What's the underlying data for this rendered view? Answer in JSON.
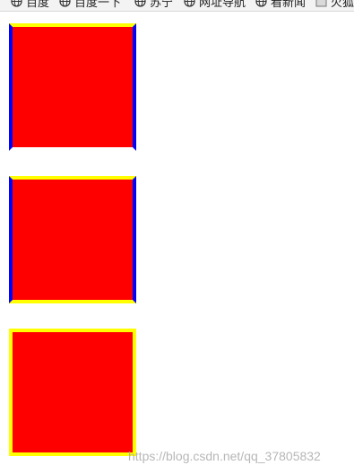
{
  "bookmarks": [
    {
      "label": "百度",
      "icon": "globe-icon"
    },
    {
      "label": "百度一下",
      "icon": "globe-icon"
    },
    {
      "label": "苏宁",
      "icon": "globe-icon"
    },
    {
      "label": "网址导航",
      "icon": "globe-icon"
    },
    {
      "label": "看新闻",
      "icon": "globe-icon"
    },
    {
      "label": "火狐",
      "icon": "folder-icon"
    }
  ],
  "boxes": [
    {
      "fill": "#ff0000",
      "border_top": "#ffff00",
      "border_right": "#0000ff",
      "border_bottom": "#ffffff",
      "border_left": "#0000ff"
    },
    {
      "fill": "#ff0000",
      "border_top": "#ffff00",
      "border_right": "#0000ff",
      "border_bottom": "#ffff00",
      "border_left": "#0000ff"
    },
    {
      "fill": "#ff0000",
      "border_top": "#ffff00",
      "border_right": "#ffff00",
      "border_bottom": "#ffff00",
      "border_left": "#ffff00"
    }
  ],
  "watermark": "https://blog.csdn.net/qq_37805832"
}
